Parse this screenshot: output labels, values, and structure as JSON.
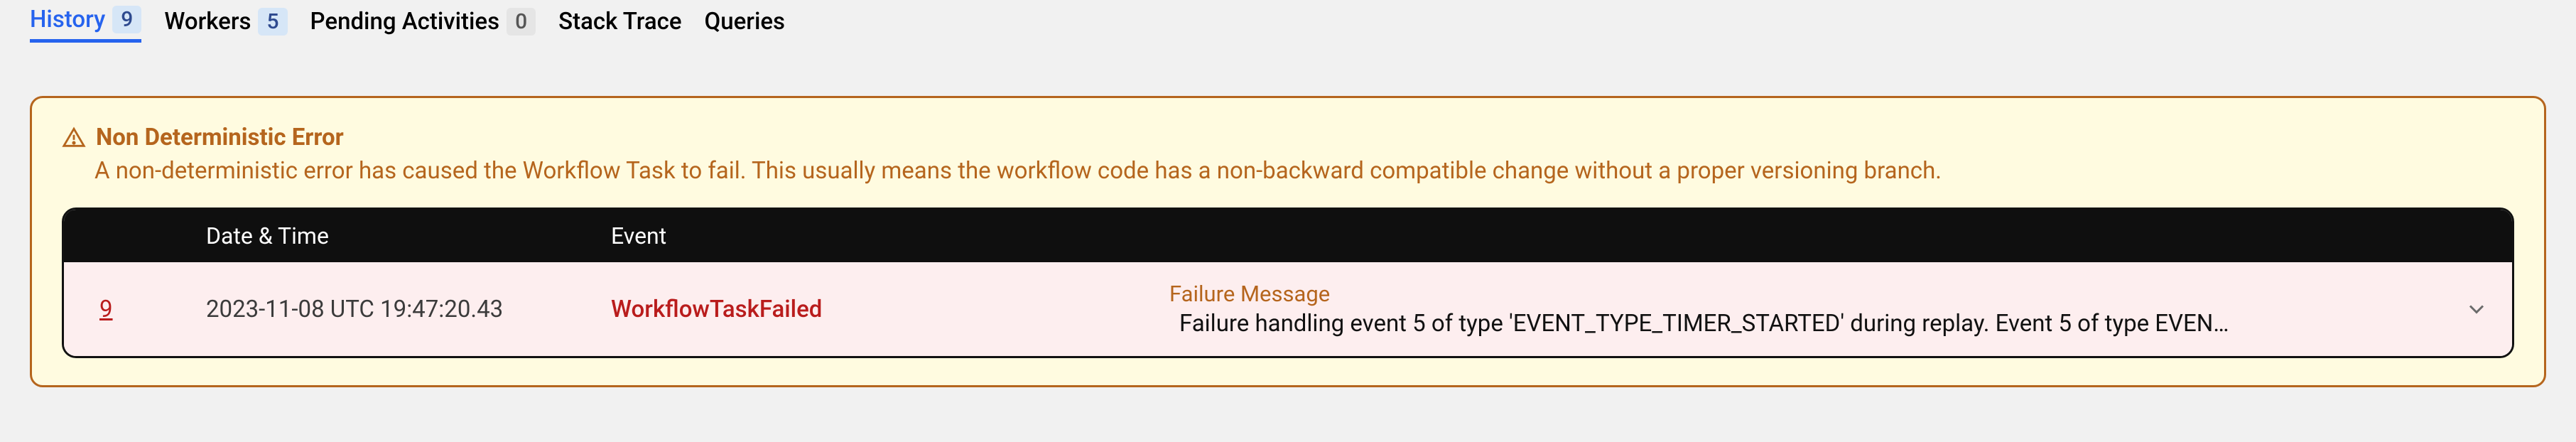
{
  "tabs": {
    "history": {
      "label": "History",
      "count": "9"
    },
    "workers": {
      "label": "Workers",
      "count": "5"
    },
    "pending": {
      "label": "Pending Activities",
      "count": "0"
    },
    "stacktrace": {
      "label": "Stack Trace"
    },
    "queries": {
      "label": "Queries"
    }
  },
  "alert": {
    "title": "Non Deterministic Error",
    "description": "A non-deterministic error has caused the Workflow Task to fail. This usually means the workflow code has a non-backward compatible change without a proper versioning branch."
  },
  "table": {
    "headers": {
      "datetime": "Date & Time",
      "event": "Event"
    },
    "row": {
      "id": "9",
      "datetime": "2023-11-08 UTC 19:47:20.43",
      "event": "WorkflowTaskFailed",
      "msg_label": "Failure Message",
      "msg_text": "Failure handling event 5 of type 'EVENT_TYPE_TIMER_STARTED' during replay. Event 5 of type EVEN…"
    }
  }
}
